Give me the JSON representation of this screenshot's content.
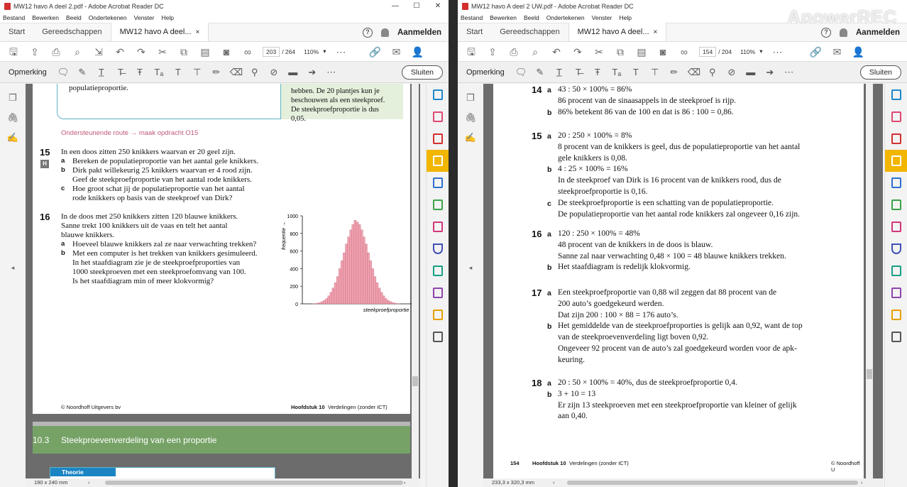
{
  "left": {
    "title": "MW12 havo A deel 2.pdf - Adobe Acrobat Reader DC",
    "menu": [
      "Bestand",
      "Bewerken",
      "Beeld",
      "Ondertekenen",
      "Venster",
      "Help"
    ],
    "tabs": {
      "start": "Start",
      "tools": "Gereedschappen",
      "doc": "MW12 havo A deel...",
      "close": "×"
    },
    "signin": "Aanmelden",
    "help": "?",
    "page_current": "203",
    "page_total": "/ 264",
    "zoom": "110%",
    "comment_label": "Opmerking",
    "close_label": "Sluiten",
    "page_size": "190 x 240 mm",
    "content": {
      "hint_left": "populatieproportie.",
      "hint_right": [
        "hebben. De 20 plantjes kun je",
        "beschouwen als een steekproef.",
        "De steekproefproportie is dus 0,05."
      ],
      "route": "Ondersteunende route → maak opdracht O15",
      "q15": {
        "num": "15",
        "badge": "H",
        "stem": "In een doos zitten 250 knikkers waarvan er 20 geel zijn.",
        "a": "Bereken de populatieproportie van het aantal gele knikkers.",
        "b1": "Dirk pakt willekeurig 25 knikkers waarvan er 4 rood zijn.",
        "b2": "Geef de steekproefproportie van het aantal rode knikkers.",
        "c1": "Hoe groot schat jij de populatieproportie van het aantal",
        "c2": "rode knikkers op basis van de steekproef van Dirk?"
      },
      "q16": {
        "num": "16",
        "stem1": "In de doos met 250 knikkers zitten 120 blauwe knikkers.",
        "stem2": "Sanne trekt 100 knikkers uit de vaas en telt het aantal",
        "stem3": "blauwe knikkers.",
        "a": "Hoeveel blauwe knikkers zal ze naar verwachting trekken?",
        "b1": "Met een computer is het trekken van knikkers gesimuleerd.",
        "b2": "In het staafdiagram zie je de steekproefproporties van",
        "b3": "1000 steekproeven met een steekproefomvang van 100.",
        "b4": "Is het staafdiagram min of meer klokvormig?"
      },
      "footer_left": "© Noordhoff Uitgevers bv",
      "footer_right_bold": "Hoofdstuk 10",
      "footer_right": "Verdelingen (zonder ICT)",
      "section_num": "10.3",
      "section_title": "Steekproevenverdeling van een proportie",
      "theory": "Theorie"
    },
    "chart_data": {
      "type": "bar",
      "xlabel": "steekproefproportie →",
      "ylabel": "frequentie →",
      "ylim": [
        0,
        1000
      ],
      "yticks": [
        0,
        200,
        400,
        600,
        800,
        1000
      ],
      "values": [
        2,
        4,
        8,
        15,
        25,
        40,
        60,
        90,
        130,
        180,
        240,
        310,
        400,
        490,
        580,
        680,
        760,
        840,
        900,
        950,
        930,
        900,
        840,
        760,
        680,
        580,
        490,
        400,
        310,
        240,
        180,
        130,
        90,
        60,
        40,
        25,
        15,
        8,
        4,
        2
      ]
    }
  },
  "right": {
    "title": "MW12 havo A deel 2 UW.pdf - Adobe Acrobat Reader DC",
    "menu": [
      "Bestand",
      "Bewerken",
      "Beeld",
      "Ondertekenen",
      "Venster",
      "Help"
    ],
    "tabs": {
      "start": "Start",
      "tools": "Gereedschappen",
      "doc": "MW12 havo A deel...",
      "close": "×"
    },
    "signin": "Aanmelden",
    "help": "?",
    "page_current": "154",
    "page_total": "/ 204",
    "zoom": "110%",
    "comment_label": "Opmerking",
    "close_label": "Sluiten",
    "page_size": "233,3 x 320,3 mm",
    "watermark": "ApowerREC",
    "answers": [
      {
        "num": "14",
        "lines": [
          {
            "l": "a",
            "t": "43 : 50 × 100% = 86%"
          },
          {
            "l": "",
            "t": "86 procent van de sinaasappels in de steekproef is rijp."
          },
          {
            "l": "b",
            "t": "86% betekent 86 van de 100 en dat is 86 : 100 = 0,86."
          }
        ]
      },
      {
        "num": "15",
        "lines": [
          {
            "l": "a",
            "t": "20 : 250 × 100% = 8%"
          },
          {
            "l": "",
            "t": "8 procent van de knikkers is geel, dus de populatieproportie van het aantal"
          },
          {
            "l": "",
            "t": "gele knikkers is 0,08."
          },
          {
            "l": "b",
            "t": "4 : 25 × 100% = 16%"
          },
          {
            "l": "",
            "t": "In de steekproef van Dirk is 16 procent van de knikkers rood, dus de"
          },
          {
            "l": "",
            "t": "steekproefproportie is 0,16."
          },
          {
            "l": "c",
            "t": "De steekproefproportie is een schatting van de populatieproportie."
          },
          {
            "l": "",
            "t": "De populatieproportie van het aantal rode knikkers zal ongeveer 0,16 zijn."
          }
        ]
      },
      {
        "num": "16",
        "lines": [
          {
            "l": "a",
            "t": "120 : 250 × 100% = 48%"
          },
          {
            "l": "",
            "t": "48 procent van de knikkers in de doos is blauw."
          },
          {
            "l": "",
            "t": "Sanne zal naar verwachting 0,48 × 100 = 48 blauwe knikkers trekken."
          },
          {
            "l": "b",
            "t": "Het staafdiagram is redelijk klokvormig."
          }
        ]
      },
      {
        "num": "17",
        "lines": [
          {
            "l": "a",
            "t": "Een steekproefproportie van 0,88 wil zeggen dat 88 procent van de"
          },
          {
            "l": "",
            "t": "200 auto’s goedgekeurd werden."
          },
          {
            "l": "",
            "t": "Dat zijn 200 : 100 × 88 = 176 auto’s."
          },
          {
            "l": "b",
            "t": "Het gemiddelde van de steekproefproporties is gelijk aan 0,92, want de top"
          },
          {
            "l": "",
            "t": "van de steekproevenverdeling ligt boven 0,92."
          },
          {
            "l": "",
            "t": "Ongeveer 92 procent van de auto’s zal goedgekeurd worden voor de apk-"
          },
          {
            "l": "",
            "t": "keuring."
          }
        ]
      },
      {
        "num": "18",
        "lines": [
          {
            "l": "a",
            "t": "20 : 50 × 100% = 40%, dus de steekproefproportie 0,4."
          },
          {
            "l": "b",
            "t": "3 + 10 = 13"
          },
          {
            "l": "",
            "t": "Er zijn 13 steekproeven met een steekproefproportie van kleiner of gelijk"
          },
          {
            "l": "",
            "t": "aan 0,40."
          }
        ]
      }
    ],
    "footer_page": "154",
    "footer_bold": "Hoofdstuk 10",
    "footer_text": "Verdelingen (zonder ICT)",
    "footer_right": "© Noordhoff U"
  },
  "colors": {
    "accent_yellow": "#f2b500",
    "acrobat_red": "#d32f2f",
    "section_green": "#76a266",
    "bar_pink": "#f0a1b0",
    "route_pink": "#c05a77"
  }
}
